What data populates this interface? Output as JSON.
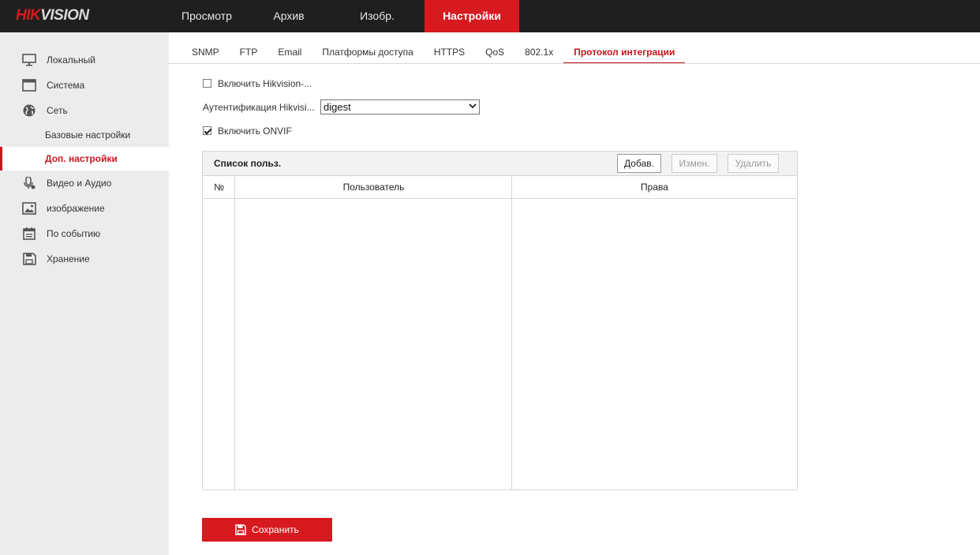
{
  "brand": {
    "part1": "HIK",
    "part2": "VISION"
  },
  "topnav": [
    "Просмотр",
    "Архив",
    "Изобр.",
    "Настройки"
  ],
  "sidebar": {
    "items": [
      {
        "label": "Локальный",
        "icon": "monitor-icon"
      },
      {
        "label": "Система",
        "icon": "system-icon"
      },
      {
        "label": "Сеть",
        "icon": "globe-icon"
      },
      {
        "label": "Базовые настройки"
      },
      {
        "label": "Доп. настройки"
      },
      {
        "label": "Видео и Аудио",
        "icon": "microphone-icon"
      },
      {
        "label": "изображение",
        "icon": "image-icon"
      },
      {
        "label": "По событию",
        "icon": "event-icon"
      },
      {
        "label": "Хранение",
        "icon": "storage-icon"
      }
    ]
  },
  "tabs": [
    "SNMP",
    "FTP",
    "Email",
    "Платформы доступа",
    "HTTPS",
    "QoS",
    "802.1x",
    "Протокол интеграции"
  ],
  "form": {
    "enable_hikvision_label": "Включить Hikvision-...",
    "enable_hikvision_checked": false,
    "auth_label": "Аутентификация Hikvisi...",
    "auth_value": "digest",
    "enable_onvif_label": "Включить ONVIF",
    "enable_onvif_checked": true
  },
  "user_list": {
    "title": "Список польз.",
    "add_label": "Добав.",
    "edit_label": "Измен.",
    "delete_label": "Удалить",
    "columns": [
      "№",
      "Пользователь",
      "Права"
    ],
    "rows": []
  },
  "save_label": "Сохранить",
  "colors": {
    "accent": "#d71920",
    "topbar": "#1f1f1f",
    "sidebar": "#ececec"
  }
}
